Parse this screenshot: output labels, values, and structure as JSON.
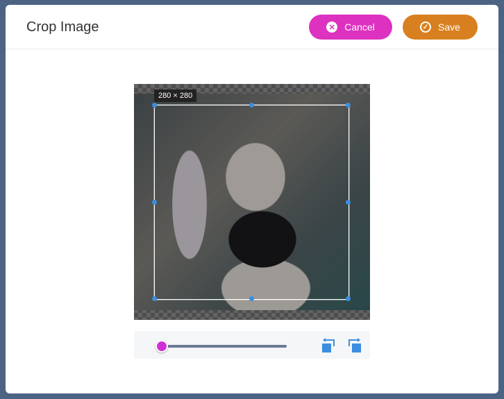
{
  "header": {
    "title": "Crop Image",
    "cancel_label": "Cancel",
    "save_label": "Save"
  },
  "cropper": {
    "size_label": "280 × 280",
    "zoom_fraction": 0.05
  },
  "icons": {
    "cancel": "x-circle-icon",
    "save": "check-circle-icon",
    "rotate_left": "rotate-left-icon",
    "rotate_right": "rotate-right-icon"
  },
  "colors": {
    "cancel": "#dd31bf",
    "save": "#d8801f",
    "handle": "#3b8ee0",
    "slider_thumb": "#d02fd4"
  }
}
